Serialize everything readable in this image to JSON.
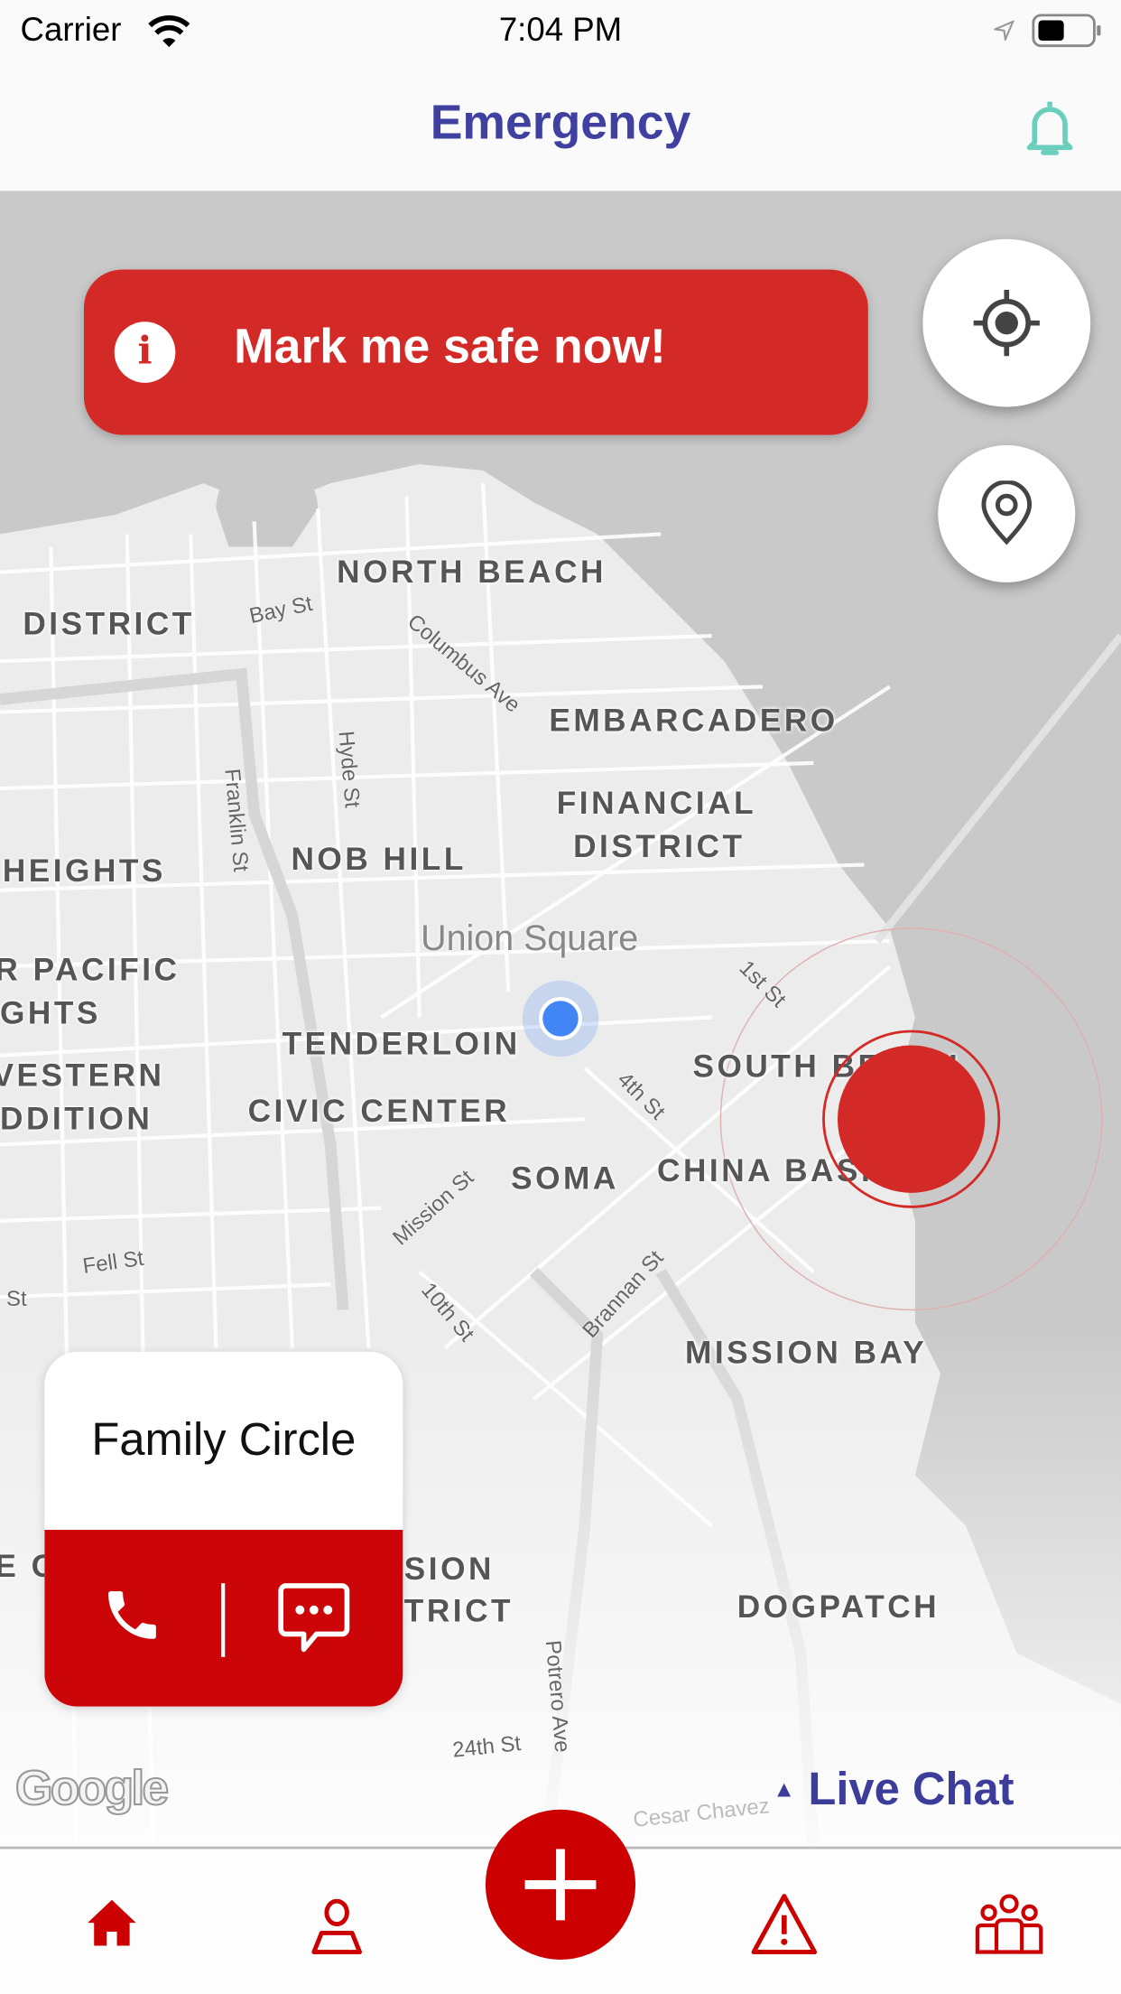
{
  "status_bar": {
    "carrier": "Carrier",
    "time": "7:04 PM",
    "icons": [
      "wifi-icon",
      "location-arrow-icon",
      "battery-icon"
    ]
  },
  "header": {
    "title": "Emergency",
    "bell_icon": "bell-icon",
    "bell_color": "#6ccfbd",
    "title_color": "#4040a0"
  },
  "banner": {
    "label": "Mark me safe now!",
    "icon": "info-icon",
    "color": "#d42a27"
  },
  "map_controls": {
    "locate_icon": "crosshair-icon",
    "pin_icon": "map-pin-icon"
  },
  "map": {
    "neighborhoods": [
      "NORTH BEACH",
      "DISTRICT",
      "EMBARCADERO",
      "FINANCIAL",
      "DISTRICT",
      "HEIGHTS",
      "NOB HILL",
      "R PACIFIC",
      "GHTS",
      "TENDERLOIN",
      "SOUTH BEACH",
      "VESTERN",
      "DDITION",
      "CIVIC CENTER",
      "SOMA",
      "CHINA BASIN",
      "MISSION BAY",
      "E O",
      "SION",
      "TRICT",
      "DOGPATCH"
    ],
    "landmark": "Union Square",
    "streets": [
      "Bay St",
      "Columbus Ave",
      "Hyde St",
      "Franklin St",
      "1st St",
      "4th St",
      "Mission St",
      "Fell St",
      "St",
      "10th St",
      "Brannan St",
      "Potrero Ave",
      "24th St",
      "Cesar Chavez"
    ],
    "attribution": "Google"
  },
  "family_card": {
    "title": "Family Circle",
    "call_icon": "phone-icon",
    "chat_icon": "chat-bubble-icon",
    "color": "#cc0508"
  },
  "live_chat": {
    "label": "Live Chat",
    "icon": "caret-up-icon"
  },
  "tab_bar": {
    "items": [
      {
        "name": "home",
        "icon": "home-icon"
      },
      {
        "name": "profile",
        "icon": "person-icon"
      },
      {
        "name": "add",
        "icon": "plus-icon"
      },
      {
        "name": "alerts",
        "icon": "warning-icon"
      },
      {
        "name": "groups",
        "icon": "group-icon"
      }
    ],
    "accent": "#cc0000"
  }
}
